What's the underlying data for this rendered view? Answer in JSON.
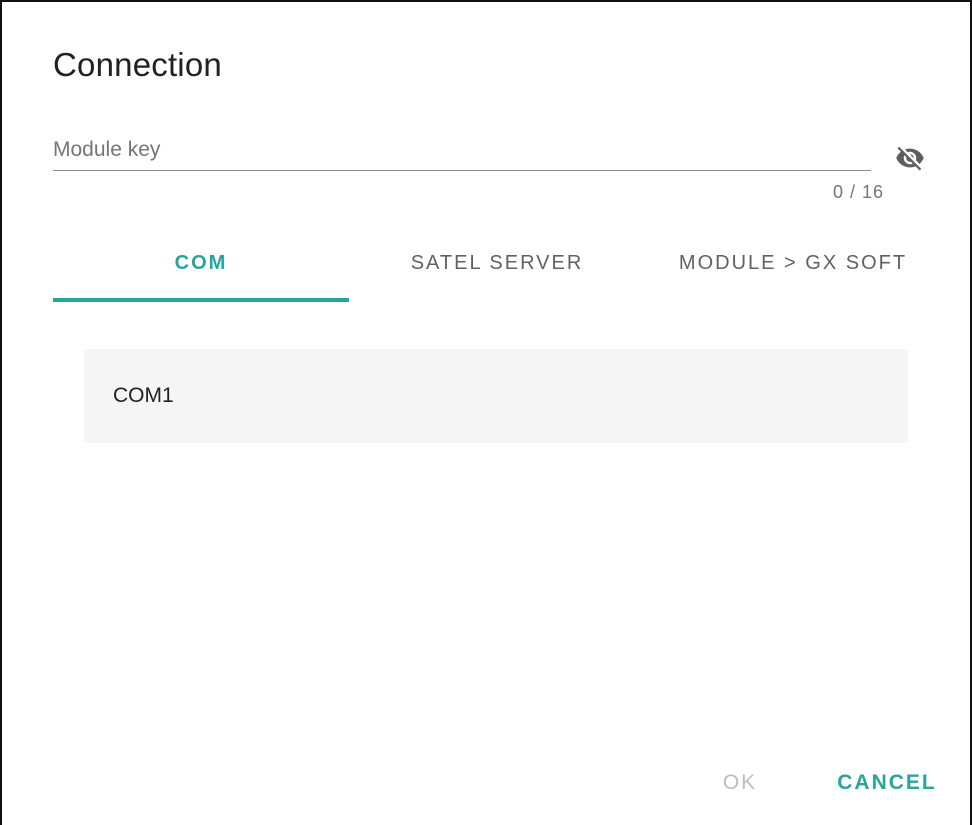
{
  "dialog": {
    "title": "Connection"
  },
  "module_key": {
    "placeholder": "Module key",
    "value": "",
    "counter": "0 / 16",
    "visibility_icon": "visibility-off-icon"
  },
  "tabs": [
    {
      "label": "COM",
      "active": true
    },
    {
      "label": "SATEL SERVER",
      "active": false
    },
    {
      "label": "MODULE > GX SOFT",
      "active": false
    }
  ],
  "ports": [
    {
      "label": "COM1"
    }
  ],
  "actions": {
    "ok_label": "OK",
    "cancel_label": "CANCEL"
  },
  "colors": {
    "accent": "#26a69a",
    "text": "#212121",
    "secondary_text": "#757575",
    "disabled": "#bdbdbd",
    "list_background": "#f5f5f5"
  }
}
